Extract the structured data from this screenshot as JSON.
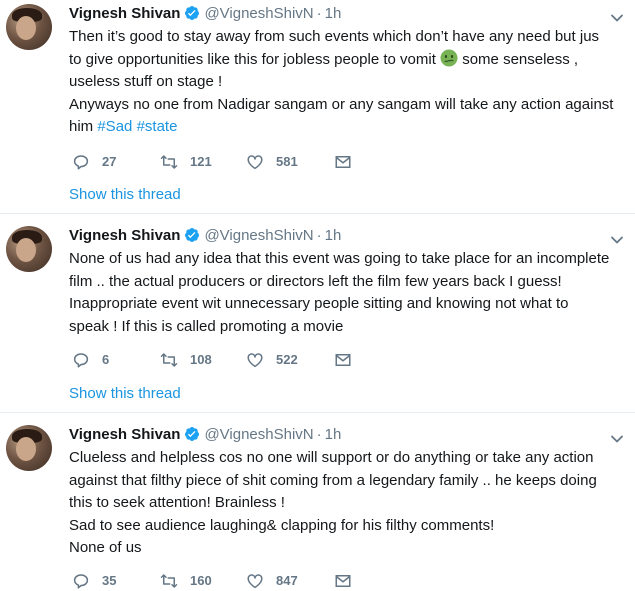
{
  "colors": {
    "link": "#1b95e0",
    "muted": "#657786",
    "divider": "#e6ecf0",
    "verified": "#1da1f2"
  },
  "tweets": [
    {
      "author_name": "Vignesh Shivan",
      "handle": "@VigneshShivN",
      "dot": "·",
      "time": "1h",
      "lines": [
        "Then it’s good to stay away from such events which don’t have any need but jus",
        "to give opportunities like this for jobless people to vomit",
        "some senseless ,",
        "useless stuff on stage !",
        "Anyways no one from Nadigar sangam or any sangam will take any action against",
        "him"
      ],
      "emoji_icon": "nauseated-face-icon",
      "hashtags": [
        "#Sad",
        "#state"
      ],
      "replies": "27",
      "retweets": "121",
      "likes": "581",
      "show_thread": "Show this thread"
    },
    {
      "author_name": "Vignesh Shivan",
      "handle": "@VigneshShivN",
      "dot": "·",
      "time": "1h",
      "lines": [
        "None of us had any idea that this event was going to take place for an incomplete",
        "film .. the actual producers or directors left the film few years back I guess!",
        "Inappropriate event wit unnecessary people sitting and knowing not what to",
        "speak ! If this is called promoting a movie"
      ],
      "replies": "6",
      "retweets": "108",
      "likes": "522",
      "show_thread": "Show this thread"
    },
    {
      "author_name": "Vignesh Shivan",
      "handle": "@VigneshShivN",
      "dot": "·",
      "time": "1h",
      "lines": [
        "Clueless and helpless cos no one will support or do anything or take any action",
        "against that filthy piece of shit coming from a legendary family .. he keeps doing",
        "this to seek attention! Brainless !",
        "Sad to see audience laughing& clapping for his filthy comments!",
        "None of us"
      ],
      "replies": "35",
      "retweets": "160",
      "likes": "847"
    }
  ]
}
